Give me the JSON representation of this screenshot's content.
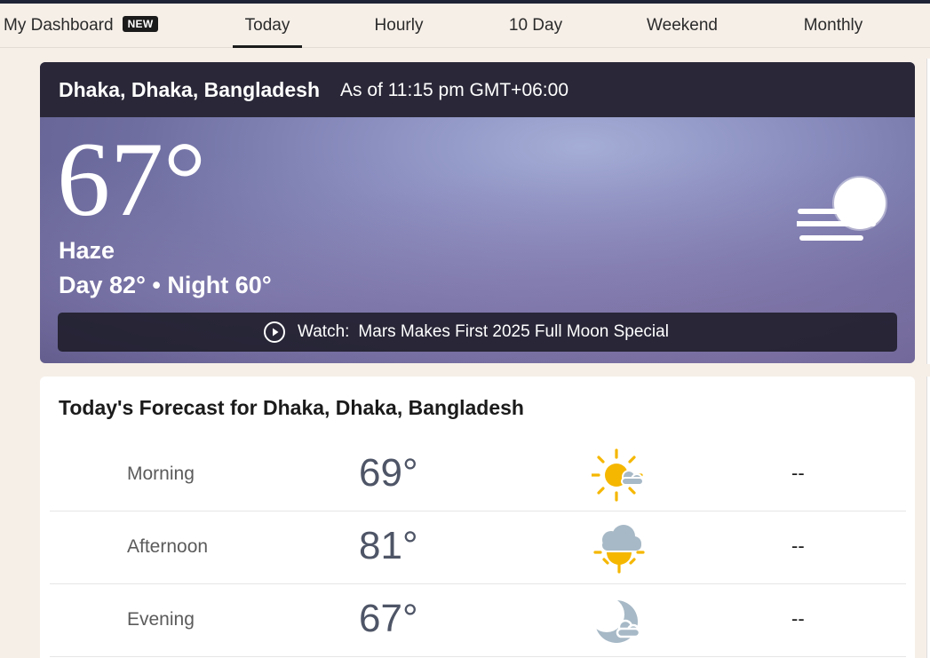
{
  "nav": {
    "dashboard_label": "My Dashboard",
    "dashboard_badge": "NEW",
    "tabs": [
      {
        "label": "Today",
        "active": true
      },
      {
        "label": "Hourly"
      },
      {
        "label": "10 Day"
      },
      {
        "label": "Weekend"
      },
      {
        "label": "Monthly"
      }
    ]
  },
  "current": {
    "location": "Dhaka, Dhaka, Bangladesh",
    "as_of": "As of 11:15 pm GMT+06:00",
    "temperature": "67°",
    "condition": "Haze",
    "day_night": "Day 82° • Night 60°",
    "icon": "haze-moon-icon",
    "watch_label": "Watch:",
    "watch_title": "Mars Makes First 2025 Full Moon Special"
  },
  "forecast": {
    "title": "Today's Forecast for Dhaka, Dhaka, Bangladesh",
    "periods": [
      {
        "name": "Morning",
        "temp": "69°",
        "icon": "partly-cloudy-sun-icon",
        "precip": "--"
      },
      {
        "name": "Afternoon",
        "temp": "81°",
        "icon": "cloudy-sun-icon",
        "precip": "--"
      },
      {
        "name": "Evening",
        "temp": "67°",
        "icon": "moon-cloud-icon",
        "precip": "--"
      }
    ]
  },
  "colors": {
    "background": "#f6efe8",
    "header_dark": "#2a2838",
    "sun": "#f5b700",
    "cloud": "#a7b9c6",
    "temp_text": "#4e5566"
  }
}
